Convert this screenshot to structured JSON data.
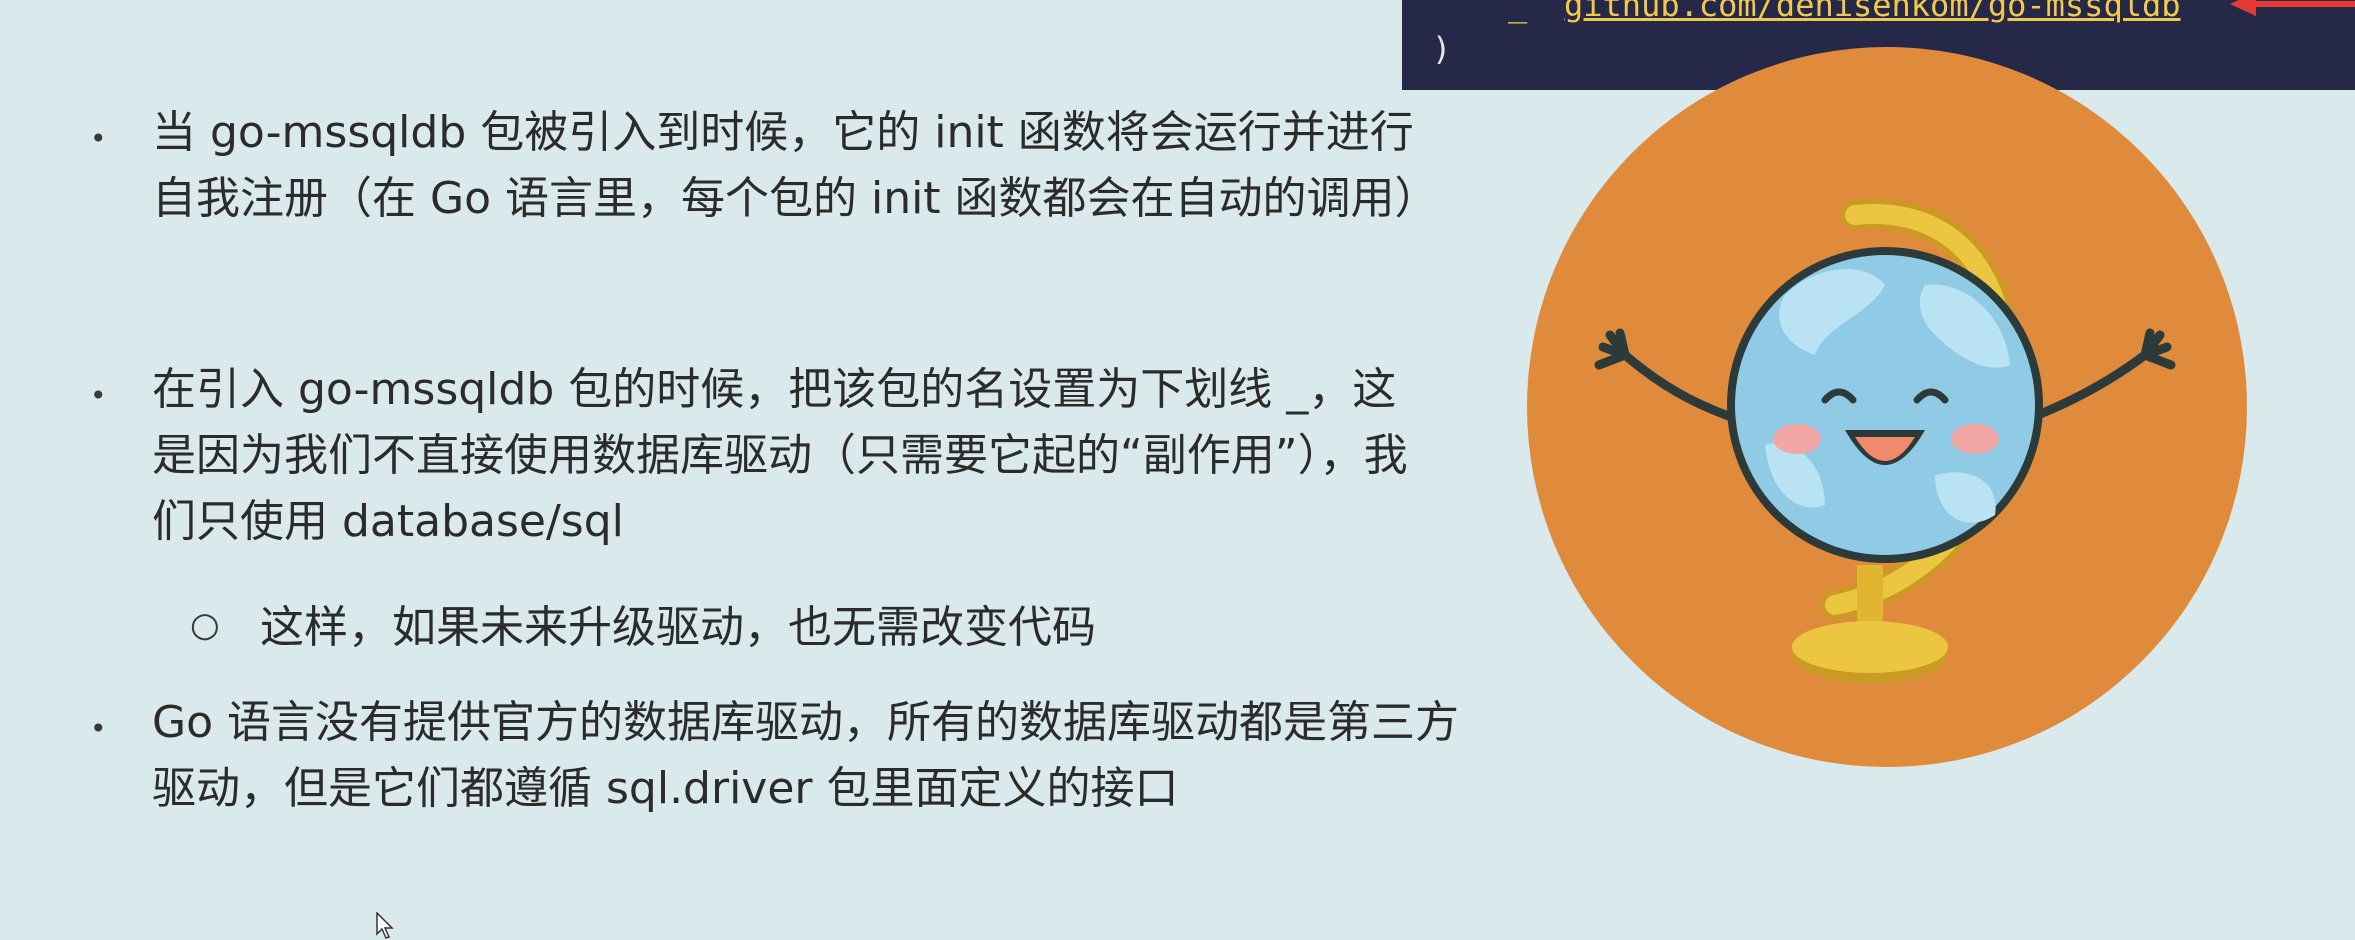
{
  "code_snippet": {
    "underscore": "_",
    "import_path": "github.com/denisenkom/go-mssqldb",
    "closing": ")",
    "accent_color": "#f2c94c",
    "arrow_color": "#e53935"
  },
  "bullets": [
    {
      "text": "当 go-mssqldb 包被引入到时候，它的 init 函数将会运行并进行自我注册（在 Go 语言里，每个包的 init 函数都会在自动的调用）"
    },
    {
      "text": "在引入 go-mssqldb 包的时候，把该包的名设置为下划线 _，这是因为我们不直接使用数据库驱动（只需要它起的“副作用”），我们只使用 database/sql"
    },
    {
      "text": "Go 语言没有提供官方的数据库驱动，所有的数据库驱动都是第三方驱动，但是它们都遵循 sql.driver 包里面定义的接口"
    }
  ],
  "sub_bullets": [
    {
      "text": "这样，如果未来升级驱动，也无需改变代码"
    }
  ],
  "illustration": {
    "icon": "smiling-globe-icon",
    "circle_color": "#e08b3c",
    "globe_color": "#8fcbe4",
    "stand_color": "#e8c23a"
  }
}
